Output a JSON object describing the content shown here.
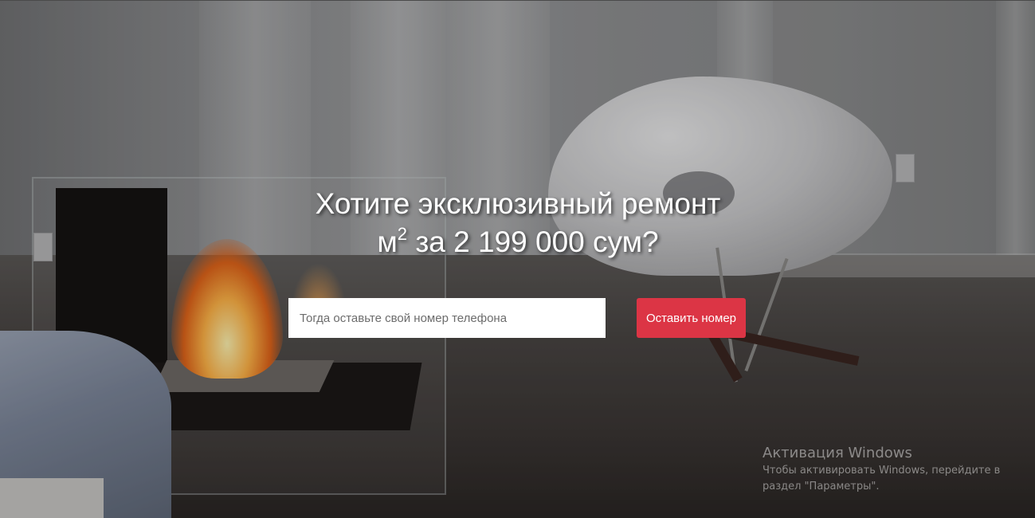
{
  "hero": {
    "headline_line1": "Хотите эксклюзивный ремонт",
    "headline_unit": "м",
    "headline_superscript": "2",
    "headline_line2_rest": " за 2 199 000 сум?"
  },
  "form": {
    "phone_placeholder": "Тогда оставьте свой номер телефона",
    "phone_value": "",
    "submit_label": "Оставить номер",
    "submit_color": "#dc3545"
  },
  "windows_watermark": {
    "title": "Активация Windows",
    "subtitle": "Чтобы активировать Windows, перейдите в раздел \"Параметры\"."
  }
}
